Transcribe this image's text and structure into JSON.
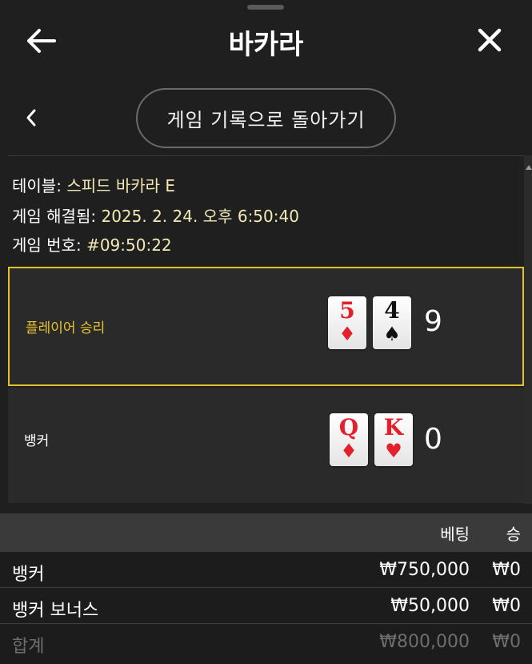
{
  "header": {
    "title": "바카라",
    "back_icon": "arrow-left-icon",
    "close_icon": "close-icon"
  },
  "history": {
    "back_label": "게임 기록으로 돌아가기",
    "chevron_icon": "chevron-left-icon"
  },
  "info": {
    "table_label": "테이블:",
    "table_value": "스피드 바카라 E",
    "resolved_label": "게임 해결됨:",
    "resolved_value": "2025. 2. 24. 오후 6:50:40",
    "game_no_label": "게임 번호:",
    "game_no_value": "#09:50:22"
  },
  "hands": {
    "player": {
      "label": "플레이어 승리",
      "cards": [
        {
          "rank": "5",
          "suit": "♦",
          "color": "#e3202b"
        },
        {
          "rank": "4",
          "suit": "♠",
          "color": "#111111"
        }
      ],
      "score": "9"
    },
    "banker": {
      "label": "뱅커",
      "cards": [
        {
          "rank": "Q",
          "suit": "♦",
          "color": "#e3202b"
        },
        {
          "rank": "K",
          "suit": "♥",
          "color": "#e3202b"
        }
      ],
      "score": "0"
    }
  },
  "bets_table": {
    "headers": {
      "bet": "베팅",
      "win": "승"
    },
    "rows": [
      {
        "name": "뱅커",
        "bet": "₩750,000",
        "win": "₩0"
      },
      {
        "name": "뱅커 보너스",
        "bet": "₩50,000",
        "win": "₩0"
      },
      {
        "name": "합계",
        "bet": "₩800,000",
        "win": "₩0"
      }
    ]
  },
  "colors": {
    "highlight": "#e2c12b",
    "background": "#1f1f1f",
    "panel": "#2a2a2a"
  }
}
